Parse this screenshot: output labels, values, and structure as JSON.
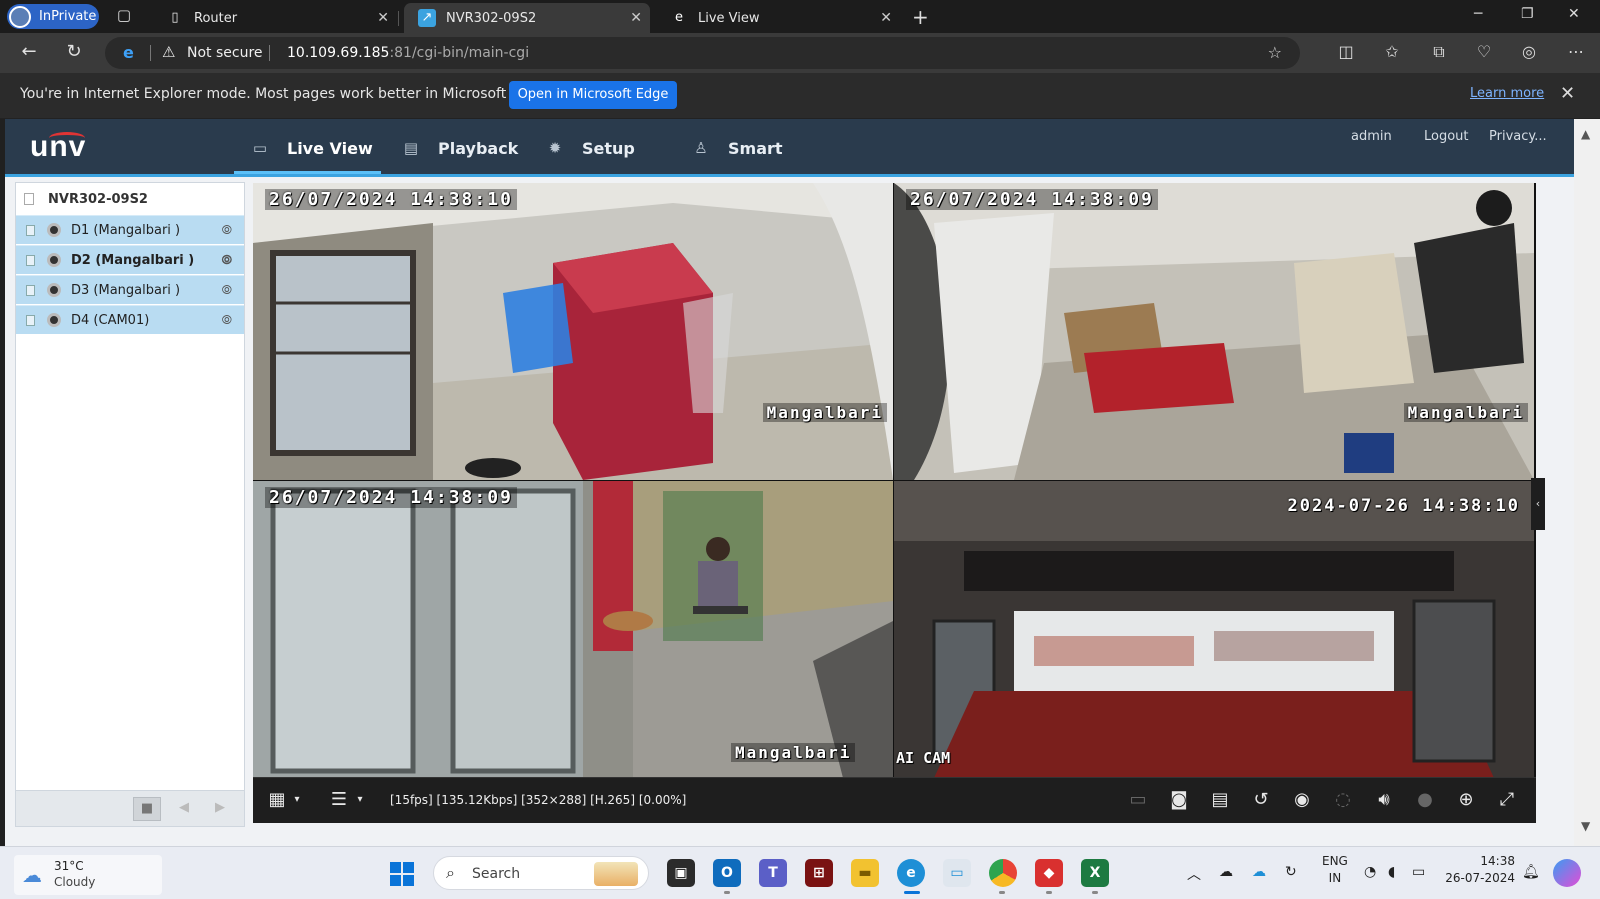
{
  "browser": {
    "inprivate_label": "InPrivate",
    "tabs": [
      {
        "title": "Router",
        "icon": "page-icon"
      },
      {
        "title": "NVR302-09S2",
        "icon": "app-icon"
      },
      {
        "title": "Live View",
        "icon": "ie-icon"
      }
    ],
    "address": {
      "security_label": "Not secure",
      "url_host": "10.109.69.185",
      "url_path": ":81/cgi-bin/main-cgi"
    },
    "infobar": {
      "message": "You're in Internet Explorer mode. Most pages work better in Microsoft Edge.",
      "open_button": "Open in Microsoft Edge",
      "learn_more": "Learn more"
    }
  },
  "app": {
    "logo": "unv",
    "nav": [
      {
        "label": "Live View",
        "icon": "monitor-icon"
      },
      {
        "label": "Playback",
        "icon": "playback-icon"
      },
      {
        "label": "Setup",
        "icon": "gear-icon"
      },
      {
        "label": "Smart",
        "icon": "smart-icon"
      }
    ],
    "header_links": {
      "user": "admin",
      "logout": "Logout",
      "privacy": "Privacy..."
    },
    "tree": {
      "root": "NVR302-09S2",
      "channels": [
        {
          "label": "D1 (Mangalbari )",
          "selected": false
        },
        {
          "label": "D2 (Mangalbari )",
          "selected": true
        },
        {
          "label": "D3 (Mangalbari )",
          "selected": false
        },
        {
          "label": "D4 (CAM01)",
          "selected": false
        }
      ]
    },
    "tiles": [
      {
        "timestamp": "26/07/2024 14:38:10",
        "name": "Mangalbari"
      },
      {
        "timestamp": "26/07/2024 14:38:09",
        "name": "Mangalbari"
      },
      {
        "timestamp": "26/07/2024 14:38:09",
        "name": "Mangalbari"
      },
      {
        "timestamp": "2024-07-26 14:38:10",
        "name": "AI CAM"
      }
    ],
    "stream_info": "[15fps] [135.12Kbps] [352×288] [H.265] [0.00%]"
  },
  "taskbar": {
    "weather_temp": "31°C",
    "weather_desc": "Cloudy",
    "search_placeholder": "Search",
    "lang_primary": "ENG",
    "lang_region": "IN",
    "time": "14:38",
    "date": "26-07-2024"
  },
  "colors": {
    "header_bg": "#2a3b4d",
    "accent": "#3ba3e0",
    "tree_selected": "#b9dcf2",
    "button_blue": "#1a73e8"
  }
}
